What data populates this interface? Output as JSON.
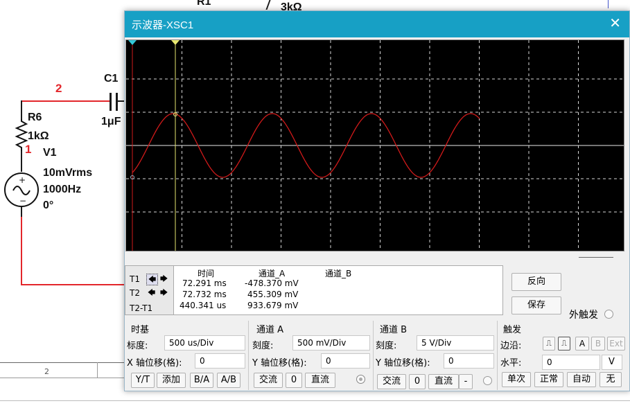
{
  "window": {
    "title": "示波器-XSC1"
  },
  "schematic": {
    "node_2": "2",
    "node_1": "1",
    "top_label_1": "R1",
    "top_label_2": "3kΩ",
    "c1_name": "C1",
    "c1_value": "1μF",
    "r6_name": "R6",
    "r6_value": "1kΩ",
    "v1_name": "V1",
    "v1_amp": "10mVrms",
    "v1_freq": "1000Hz",
    "v1_phase": "0°",
    "bottom_num": "2"
  },
  "readout": {
    "headers": [
      "时间",
      "通道_A",
      "通道_B"
    ],
    "rows": [
      {
        "label": "T1",
        "time": "72.291 ms",
        "cha": "-478.370 mV",
        "chb": ""
      },
      {
        "label": "T2",
        "time": "72.732 ms",
        "cha": "455.309 mV",
        "chb": ""
      },
      {
        "label": "T2-T1",
        "time": "440.341 us",
        "cha": "933.679 mV",
        "chb": ""
      }
    ],
    "reverse_btn": "反向",
    "save_btn": "保存",
    "ext_trigger": "外触发"
  },
  "timebase": {
    "title": "时基",
    "scale_label": "标度:",
    "scale_value": "500 us/Div",
    "xpos_label": "X 轴位移(格):",
    "xpos_value": "0",
    "btn_yt": "Y/T",
    "btn_add": "添加",
    "btn_ba": "B/A",
    "btn_ab": "A/B"
  },
  "channel_a": {
    "title": "通道 A",
    "scale_label": "刻度:",
    "scale_value": "500 mV/Div",
    "ypos_label": "Y 轴位移(格):",
    "ypos_value": "0",
    "btn_ac": "交流",
    "btn_zero": "0",
    "btn_dc": "直流"
  },
  "channel_b": {
    "title": "通道 B",
    "scale_label": "刻度:",
    "scale_value": "5  V/Div",
    "ypos_label": "Y 轴位移(格):",
    "ypos_value": "0",
    "btn_ac": "交流",
    "btn_zero": "0",
    "btn_dc": "直流",
    "btn_minus": "-"
  },
  "trigger": {
    "title": "触发",
    "edge_label": "边沿:",
    "btn_a": "A",
    "btn_b": "B",
    "btn_ext": "Ext",
    "level_label": "水平:",
    "level_value": "0",
    "level_unit": "V",
    "btn_single": "单次",
    "btn_normal": "正常",
    "btn_auto": "自动",
    "btn_none": "无"
  },
  "colors": {
    "titlebar": "#17a0c5",
    "wire": "#e3262b",
    "trace": "#d11a1a",
    "screen": "#000000"
  }
}
